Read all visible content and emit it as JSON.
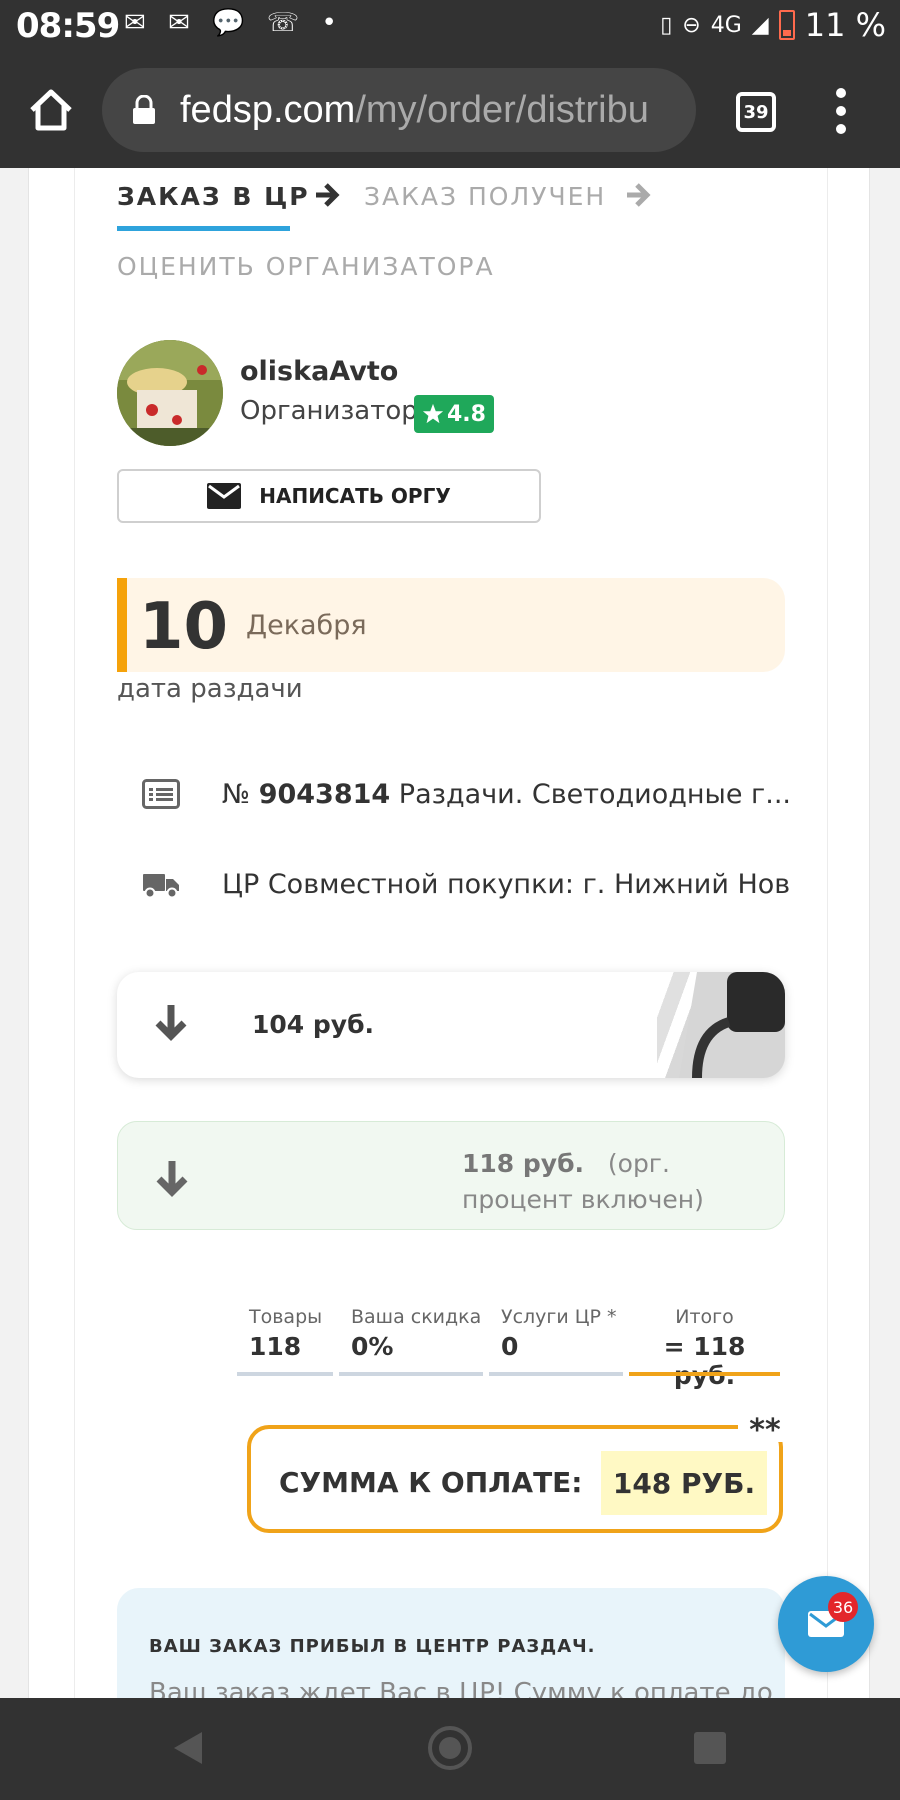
{
  "status_bar": {
    "time": "08:59",
    "network": "4G",
    "battery": "11 %"
  },
  "browser": {
    "url_host": "fedsp.com",
    "url_path": "/my/order/distribu",
    "tab_count": "39"
  },
  "steps": {
    "step1": "ЗАКАЗ В ЦР",
    "step2": "ЗАКАЗ ПОЛУЧЕН",
    "step3": "ОЦЕНИТЬ ОРГАНИЗАТОРА"
  },
  "organizer": {
    "name": "oliskaAvto",
    "role": "Организатор",
    "rating": "4.8",
    "write_button": "НАПИСАТЬ ОРГУ"
  },
  "distribution": {
    "day": "10",
    "month": "Декабря",
    "caption": "дата раздачи"
  },
  "order": {
    "number_prefix": "№",
    "number": "9043814",
    "title": "Раздачи. Светодиодные г...",
    "center": "ЦР Совместной покупки: г. Нижний Новгород"
  },
  "prices": {
    "item_price": "104 руб.",
    "price_with_fee": "118 руб.",
    "fee_note": "(орг. процент включен)"
  },
  "totals": {
    "goods_label": "Товары",
    "goods_value": "118",
    "discount_label": "Ваша скидка",
    "discount_value": "0%",
    "services_label": "Услуги ЦР *",
    "services_value": "0",
    "total_label": "Итого",
    "total_value": "= 118 руб."
  },
  "payment": {
    "label": "СУММА К ОПЛАТЕ:",
    "amount": "148 РУБ.",
    "footnote_mark": "**"
  },
  "notice": {
    "title": "ВАШ ЗАКАЗ ПРИБЫЛ В ЦЕНТР РАЗДАЧ.",
    "text": "Ваш заказ ждет Вас в ЦР! Сумму к оплате до"
  },
  "messages": {
    "badge_count": "36"
  },
  "colors": {
    "accent_blue": "#2ea3dc",
    "accent_orange": "#f0a319",
    "rating_green": "#1fa85a",
    "badge_red": "#e3262b"
  }
}
